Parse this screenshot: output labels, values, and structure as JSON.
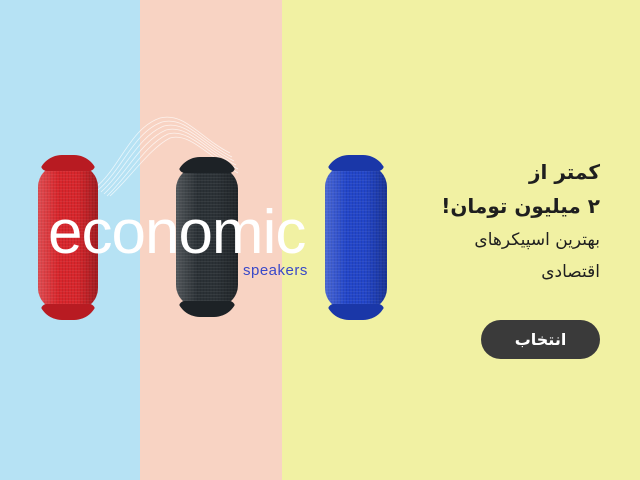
{
  "banner": {
    "brand_word": "economic",
    "brand_sub": "speakers",
    "headline_line1": "کمتر از",
    "headline_line2": "۲ میلیون تومان!",
    "subline_line1": "بهترین اسپیکرهای",
    "subline_line2": "اقتصادی",
    "select_button_label": "انتخاب"
  },
  "colors": {
    "panel_blue": "#b6e2f4",
    "panel_pink": "#f8d3c3",
    "panel_yellow": "#f1f1a3",
    "speaker_red": "#d8262c",
    "speaker_black": "#2b3136",
    "speaker_blue": "#2346c9",
    "button_bg": "#3a3a3a",
    "brand_sub": "#3a49c8"
  }
}
